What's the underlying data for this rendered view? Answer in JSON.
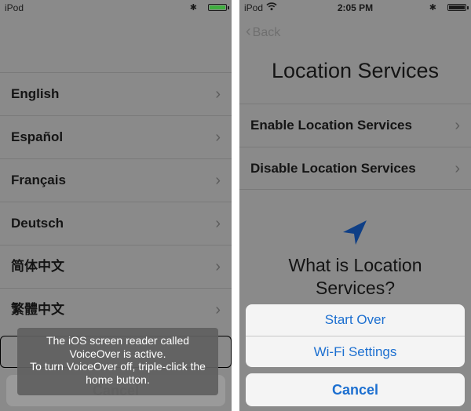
{
  "left_screen": {
    "status": {
      "carrier": "iPod",
      "bluetooth": "✱",
      "battery_level": 1.0
    },
    "languages": [
      "English",
      "Español",
      "Français",
      "Deutsch",
      "简体中文",
      "繁體中文"
    ],
    "chevron": "›",
    "hidden_cancel_label": "Cancel",
    "voiceover_message": {
      "line1": "The iOS screen reader called",
      "line2": "VoiceOver is active.",
      "line3": "To turn VoiceOver off, triple-click the",
      "line4": "home button."
    }
  },
  "right_screen": {
    "status": {
      "carrier": "iPod",
      "time": "2:05 PM",
      "bluetooth": "✱",
      "battery_level": 1.0
    },
    "back_label": "Back",
    "back_chevron": "‹",
    "title": "Location Services",
    "options": [
      "Enable Location Services",
      "Disable Location Services"
    ],
    "chevron": "›",
    "info_line1": "What is Location",
    "info_line2": "Services?",
    "action_sheet": {
      "start_over": "Start Over",
      "wifi_settings": "Wi-Fi Settings",
      "cancel": "Cancel"
    }
  },
  "icons": [
    "wifi-icon",
    "bluetooth-icon",
    "battery-icon",
    "location-arrow-icon",
    "chevron-right-icon",
    "chevron-left-icon"
  ],
  "colors": {
    "dim_background": "#8a8a8a",
    "ios_blue": "#1c6fd0",
    "battery_green": "#3fae3f",
    "sheet_background": "#f4f4f4"
  }
}
